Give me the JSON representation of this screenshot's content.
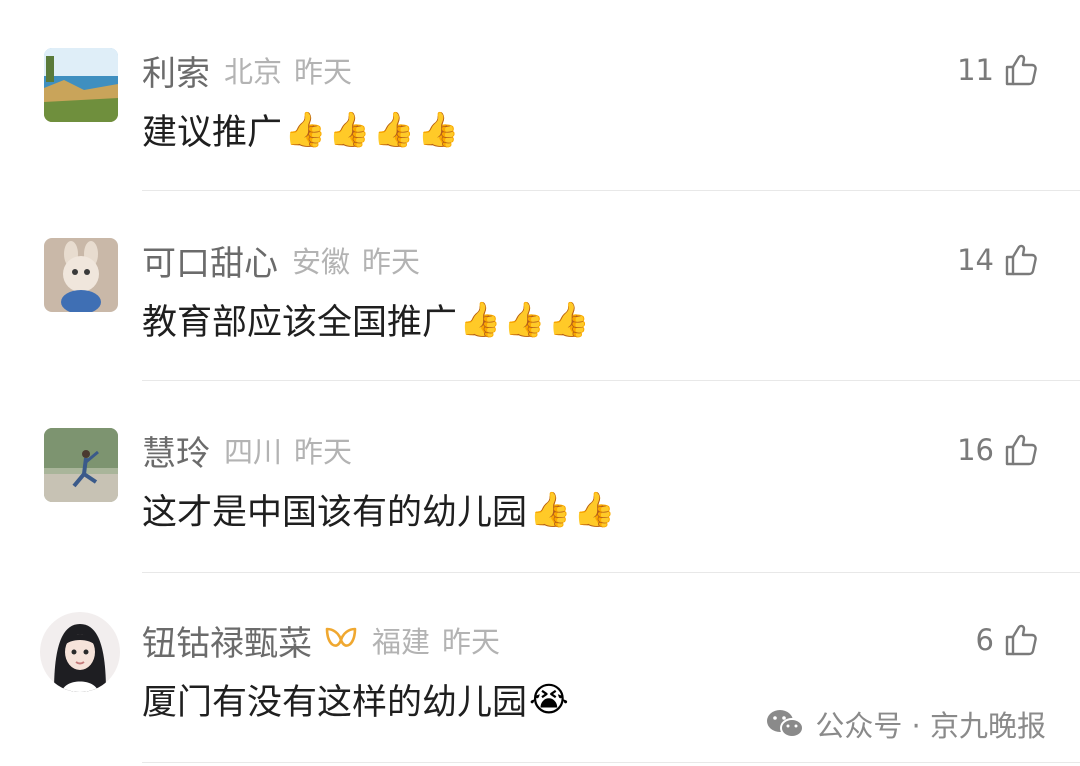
{
  "comments": [
    {
      "username": "利索",
      "region": "北京",
      "time": "昨天",
      "likes": "11",
      "text": "建议推广",
      "emojis": [
        "👍",
        "👍",
        "👍",
        "👍"
      ]
    },
    {
      "username": "可口甜心",
      "region": "安徽",
      "time": "昨天",
      "likes": "14",
      "text": "教育部应该全国推广",
      "emojis": [
        "👍",
        "👍",
        "👍"
      ]
    },
    {
      "username": "慧玲",
      "region": "四川",
      "time": "昨天",
      "likes": "16",
      "text": "这才是中国该有的幼儿园",
      "emojis": [
        "👍",
        "👍"
      ]
    },
    {
      "username": "钮钴禄甄菜",
      "region": "福建",
      "time": "昨天",
      "likes": "6",
      "text": "厦门有没有这样的幼儿园",
      "emojis": [
        "😭"
      ]
    }
  ],
  "watermark": {
    "text": "公众号 · 京九晚报",
    "icon": "wechat-icon"
  },
  "colors": {
    "username": "#6b6b6b",
    "meta": "#b3b3b3",
    "text": "#1f1f1f",
    "divider": "#e8e8e8",
    "badge": "#f0a830"
  }
}
